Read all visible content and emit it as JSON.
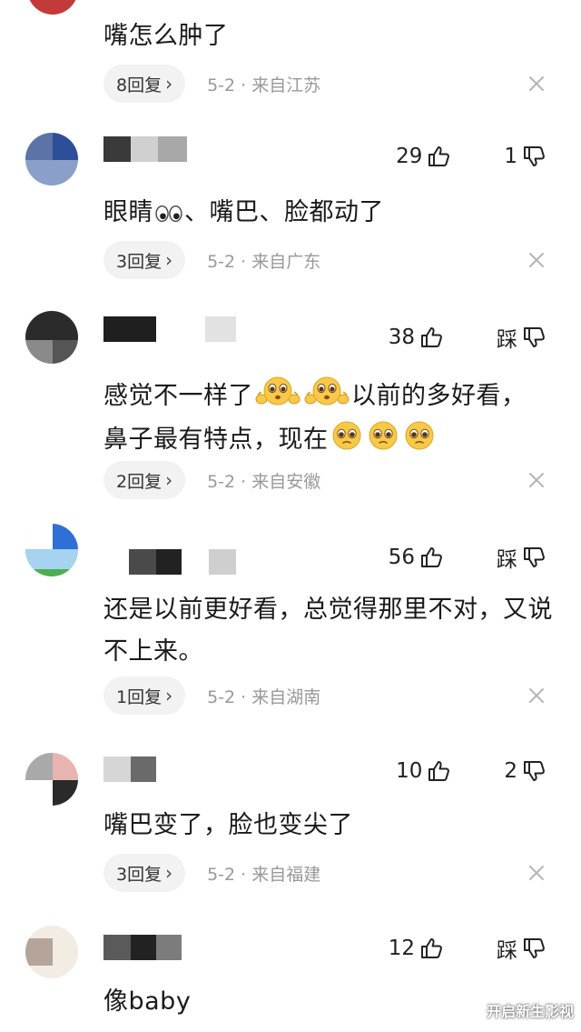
{
  "comments": [
    {
      "text": "嘴怎么肿了",
      "reply_label": "8回复",
      "meta": "5-2 · 来自江苏"
    },
    {
      "likes": "29",
      "dislike": "1",
      "text_parts": [
        "眼睛",
        "、嘴巴、脸都动了"
      ],
      "reply_label": "3回复",
      "meta": "5-2 · 来自广东"
    },
    {
      "likes": "38",
      "dislike": "踩",
      "line1": "感觉不一样了",
      "line1b": "以前的多好看，",
      "line2": "鼻子最有特点，现在",
      "reply_label": "2回复",
      "meta": "5-2 · 来自安徽"
    },
    {
      "likes": "56",
      "dislike": "踩",
      "text": "还是以前更好看，总觉得那里不对，又说不上来。",
      "reply_label": "1回复",
      "meta": "5-2 · 来自湖南"
    },
    {
      "likes": "10",
      "dislike": "2",
      "text": "嘴巴变了，脸也变尖了",
      "reply_label": "3回复",
      "meta": "5-2 · 来自福建"
    },
    {
      "likes": "12",
      "dislike": "踩",
      "text": "像baby"
    }
  ],
  "icons": {
    "like": "thumbs-up-icon",
    "dislike": "thumbs-down-icon",
    "close": "close-icon",
    "chevron": "chevron-right-icon"
  },
  "watermark": "开启新生影视"
}
